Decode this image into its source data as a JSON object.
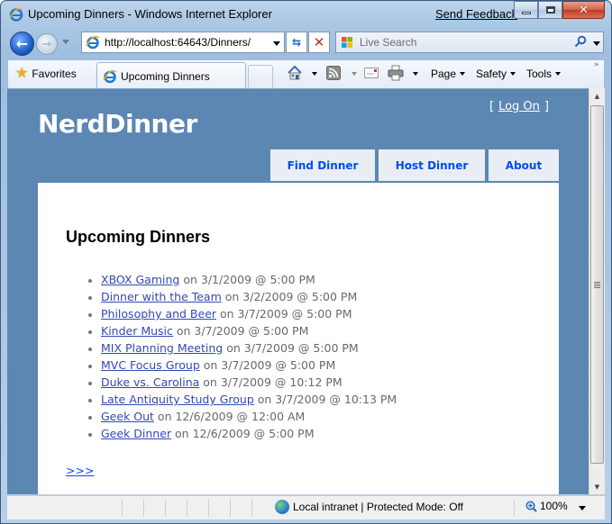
{
  "window": {
    "title": "Upcoming Dinners - Windows Internet Explorer",
    "send_feedback": "Send Feedback",
    "close_glyph": "✕"
  },
  "nav": {
    "back_glyph": "←",
    "forward_glyph": "→",
    "address": "http://localhost:64643/Dinners/",
    "refresh_glyph": "⇆",
    "stop_glyph": "✕",
    "search_placeholder": "Live Search"
  },
  "toolbar": {
    "favorites": "Favorites",
    "tab_title": "Upcoming Dinners",
    "commands": [
      "Page",
      "Safety",
      "Tools"
    ],
    "overflow": "»"
  },
  "site": {
    "logo": "NerdDinner",
    "logon_open": "[",
    "logon_label": "Log On",
    "logon_close": "]",
    "menu": [
      "Find Dinner",
      "Host Dinner",
      "About"
    ]
  },
  "main": {
    "title": "Upcoming Dinners",
    "dinners": [
      {
        "name": "XBOX Gaming",
        "when": " on 3/1/2009 @ 5:00 PM"
      },
      {
        "name": "Dinner with the Team",
        "when": " on 3/2/2009 @ 5:00 PM"
      },
      {
        "name": "Philosophy and Beer",
        "when": " on 3/7/2009 @ 5:00 PM"
      },
      {
        "name": "Kinder Music",
        "when": " on 3/7/2009 @ 5:00 PM"
      },
      {
        "name": "MIX Planning Meeting",
        "when": " on 3/7/2009 @ 5:00 PM"
      },
      {
        "name": "MVC Focus Group",
        "when": " on 3/7/2009 @ 5:00 PM"
      },
      {
        "name": "Duke vs. Carolina",
        "when": " on 3/7/2009 @ 10:12 PM"
      },
      {
        "name": "Late Antiquity Study Group",
        "when": " on 3/7/2009 @ 10:13 PM"
      },
      {
        "name": "Geek Out",
        "when": " on 12/6/2009 @ 12:00 AM"
      },
      {
        "name": "Geek Dinner",
        "when": " on 12/6/2009 @ 5:00 PM"
      }
    ],
    "next_link": ">>>"
  },
  "status": {
    "zone": "Local intranet | Protected Mode: Off",
    "zoom": "100%"
  },
  "colors": {
    "site_background": "#5c87b2",
    "menu_link": "#034af3",
    "list_link": "#3348b5",
    "text_gray": "#696969"
  }
}
